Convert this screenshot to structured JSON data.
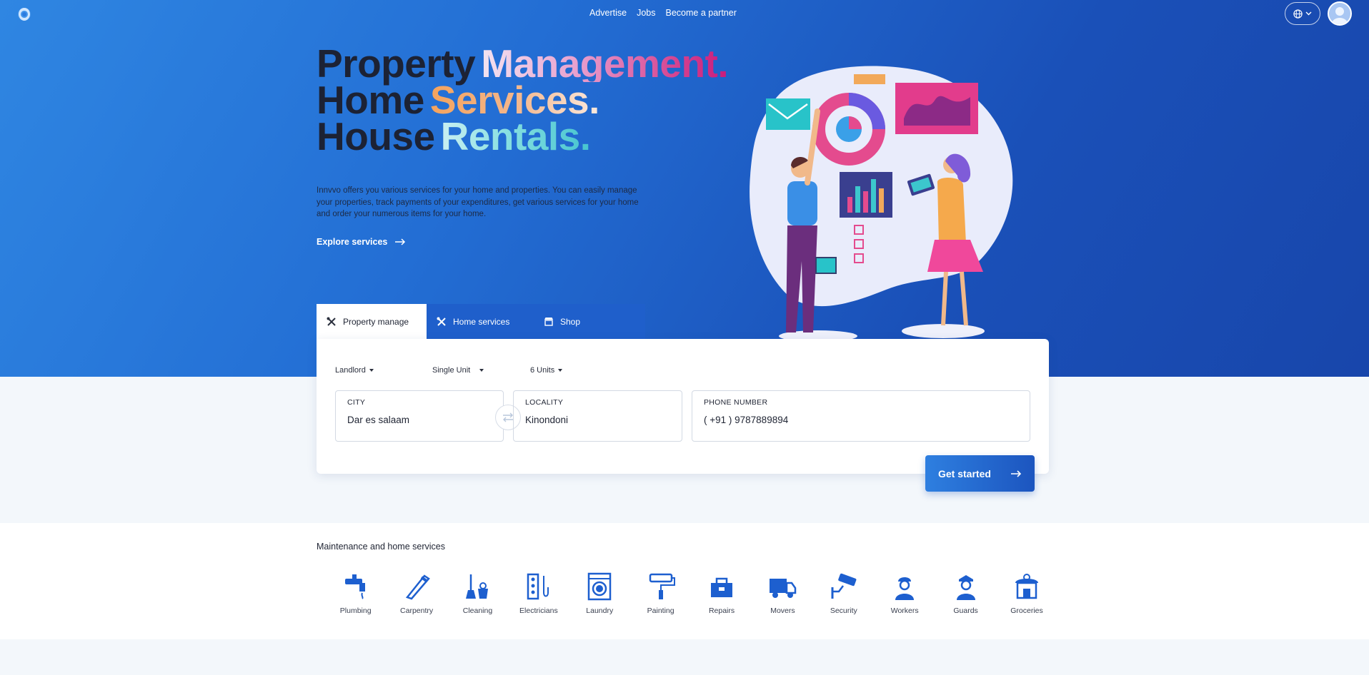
{
  "nav": {
    "links": [
      "Advertise",
      "Jobs",
      "Become a partner"
    ]
  },
  "hero": {
    "line1_dark": "Property",
    "line1_color": "Management.",
    "line2_dark": "Home",
    "line2_color": "Services.",
    "line3_dark": "House",
    "line3_color": "Rentals.",
    "description": "Innvvo offers you various services for your home and properties. You can easily manage your properties, track payments of your expenditures, get various services for your home and order your numerous items for your home.",
    "explore_label": "Explore services"
  },
  "tabs": [
    {
      "label": "Property manage",
      "icon": "tools-icon"
    },
    {
      "label": "Home services",
      "icon": "tools-icon"
    },
    {
      "label": "Shop",
      "icon": "store-icon"
    }
  ],
  "form": {
    "role": "Landlord",
    "unit_type": "Single Unit",
    "units": "6 Units",
    "city_label": "CITY",
    "city_value": "Dar es salaam",
    "locality_label": "LOCALITY",
    "locality_value": "Kinondoni",
    "phone_label": "PHONE NUMBER",
    "phone_value": "( +91 ) 9787889894",
    "cta_label": "Get started"
  },
  "services": {
    "title": "Maintenance and home services",
    "items": [
      "Plumbing",
      "Carpentry",
      "Cleaning",
      "Electricians",
      "Laundry",
      "Painting",
      "Repairs",
      "Movers",
      "Security",
      "Workers",
      "Guards",
      "Groceries"
    ]
  },
  "colors": {
    "hero_start": "#2f86e2",
    "hero_end": "#1846ab",
    "accent_blue": "#1f5fcb",
    "icon_blue": "#1d5fcf"
  }
}
